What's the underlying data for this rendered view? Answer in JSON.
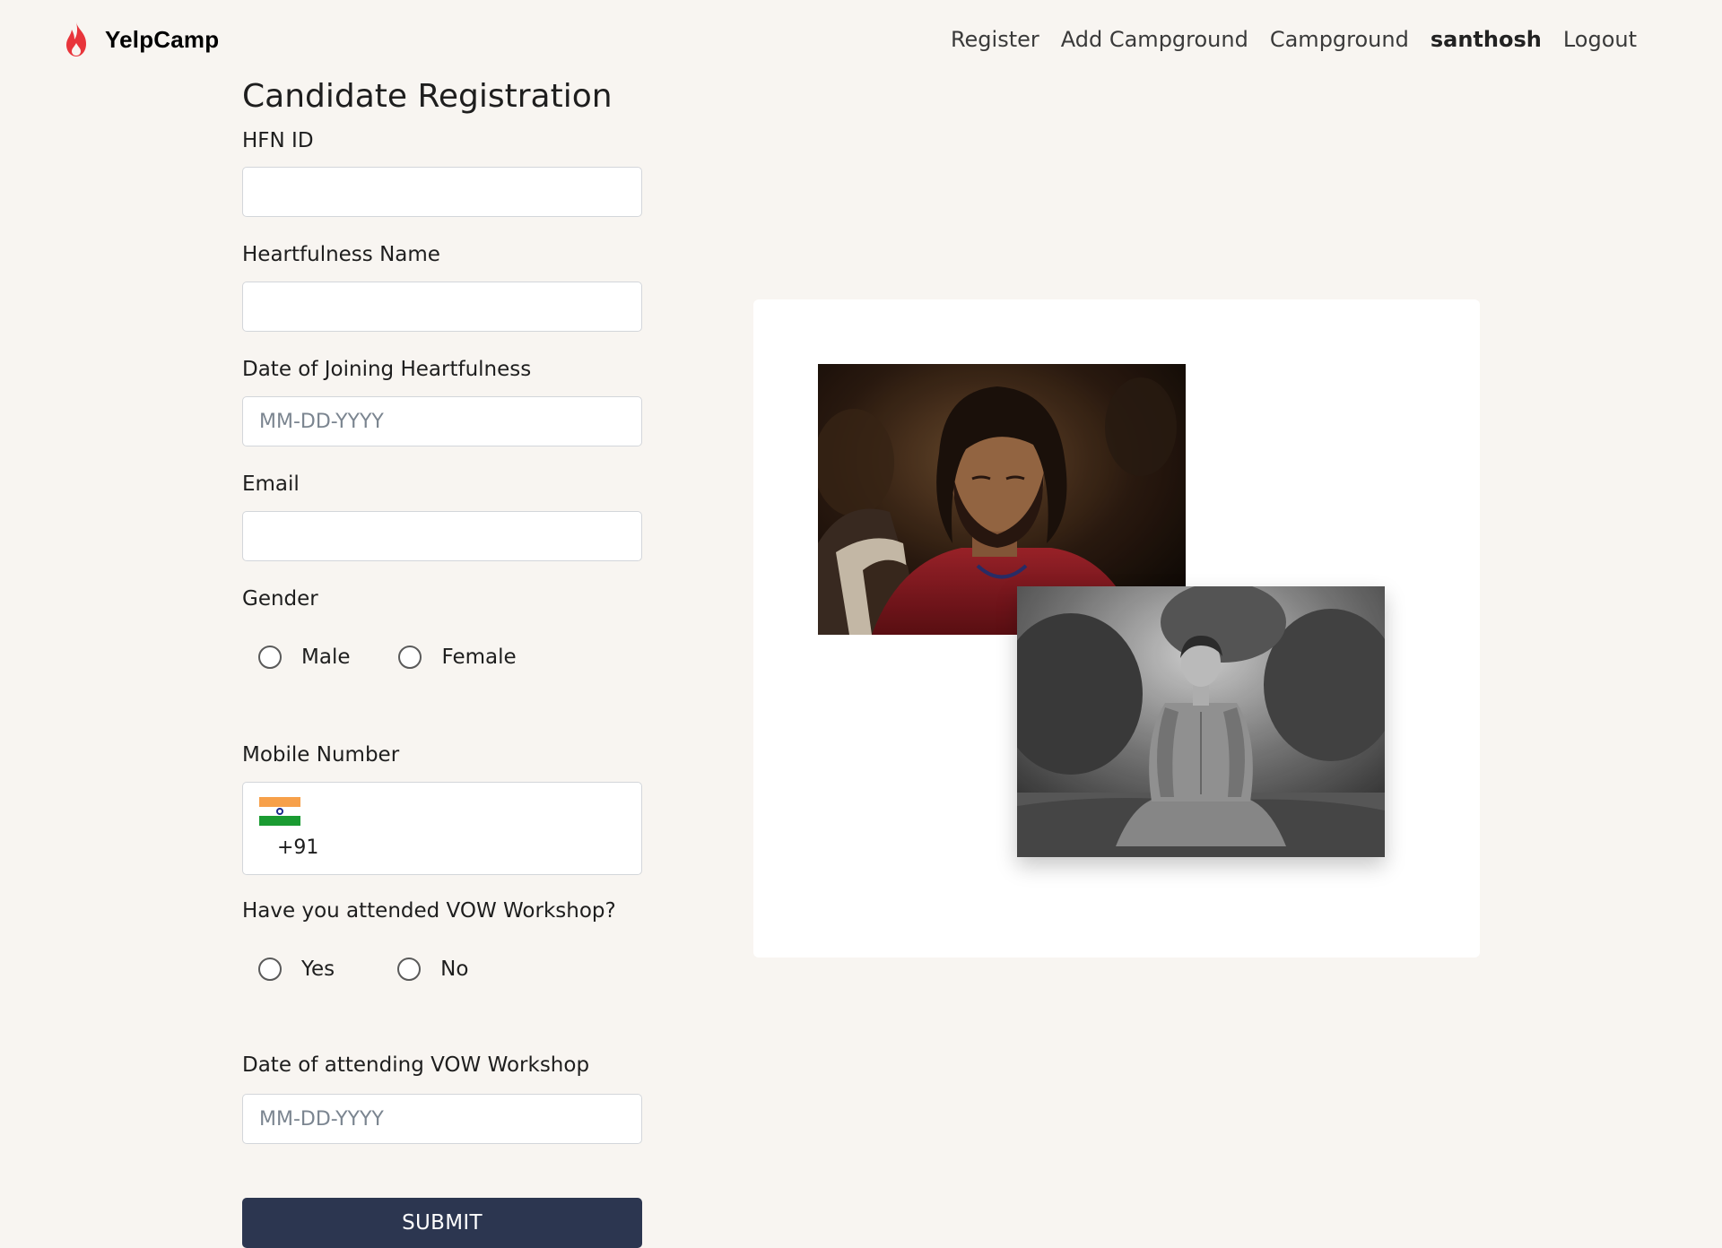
{
  "brand": {
    "name": "YelpCamp",
    "icon": "flame-icon",
    "icon_color": "#e8353b"
  },
  "nav": {
    "links": [
      {
        "label": "Register"
      },
      {
        "label": "Add Campground"
      },
      {
        "label": "Campground"
      },
      {
        "label": "santhosh"
      },
      {
        "label": "Logout"
      }
    ]
  },
  "form": {
    "title": "Candidate Registration",
    "hfn_id": {
      "label": "HFN ID",
      "value": "",
      "placeholder": ""
    },
    "heartfulness_name": {
      "label": "Heartfulness Name",
      "value": "",
      "placeholder": ""
    },
    "date_joining": {
      "label": "Date of Joining Heartfulness",
      "value": "",
      "placeholder": "MM-DD-YYYY"
    },
    "email": {
      "label": "Email",
      "value": "",
      "placeholder": ""
    },
    "gender": {
      "label": "Gender",
      "options": [
        {
          "label": "Male"
        },
        {
          "label": "Female"
        }
      ]
    },
    "mobile": {
      "label": "Mobile Number",
      "country_flag": "india-flag-icon",
      "dial_code": "+91",
      "value": ""
    },
    "vow_attended": {
      "label": "Have you attended VOW Workshop?",
      "options": [
        {
          "label": "Yes"
        },
        {
          "label": "No"
        }
      ]
    },
    "vow_date": {
      "label": "Date of attending VOW Workshop",
      "value": "",
      "placeholder": "MM-DD-YYYY"
    },
    "submit_label": "SUBMIT"
  },
  "colors": {
    "page_background": "#f8f5f1",
    "button": "#2c3650",
    "card": "#ffffff"
  }
}
